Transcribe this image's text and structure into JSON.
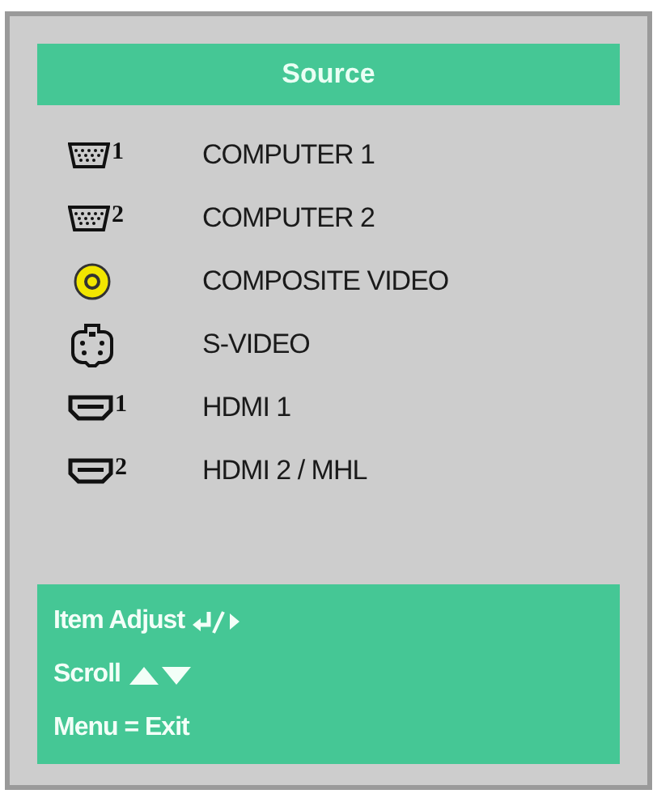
{
  "title": "Source",
  "sources": [
    {
      "kind": "vga",
      "port": "1",
      "label": "COMPUTER 1"
    },
    {
      "kind": "vga",
      "port": "2",
      "label": "COMPUTER 2"
    },
    {
      "kind": "composite",
      "label": "COMPOSITE VIDEO"
    },
    {
      "kind": "svideo",
      "label": "S-VIDEO"
    },
    {
      "kind": "hdmi",
      "port": "1",
      "label": "HDMI 1"
    },
    {
      "kind": "hdmi",
      "port": "2",
      "label": "HDMI 2 / MHL"
    }
  ],
  "help": [
    {
      "kind": "adjust",
      "text": "Item Adjust"
    },
    {
      "kind": "scroll",
      "text": "Scroll"
    },
    {
      "kind": "plain",
      "text": "Menu = Exit"
    }
  ]
}
